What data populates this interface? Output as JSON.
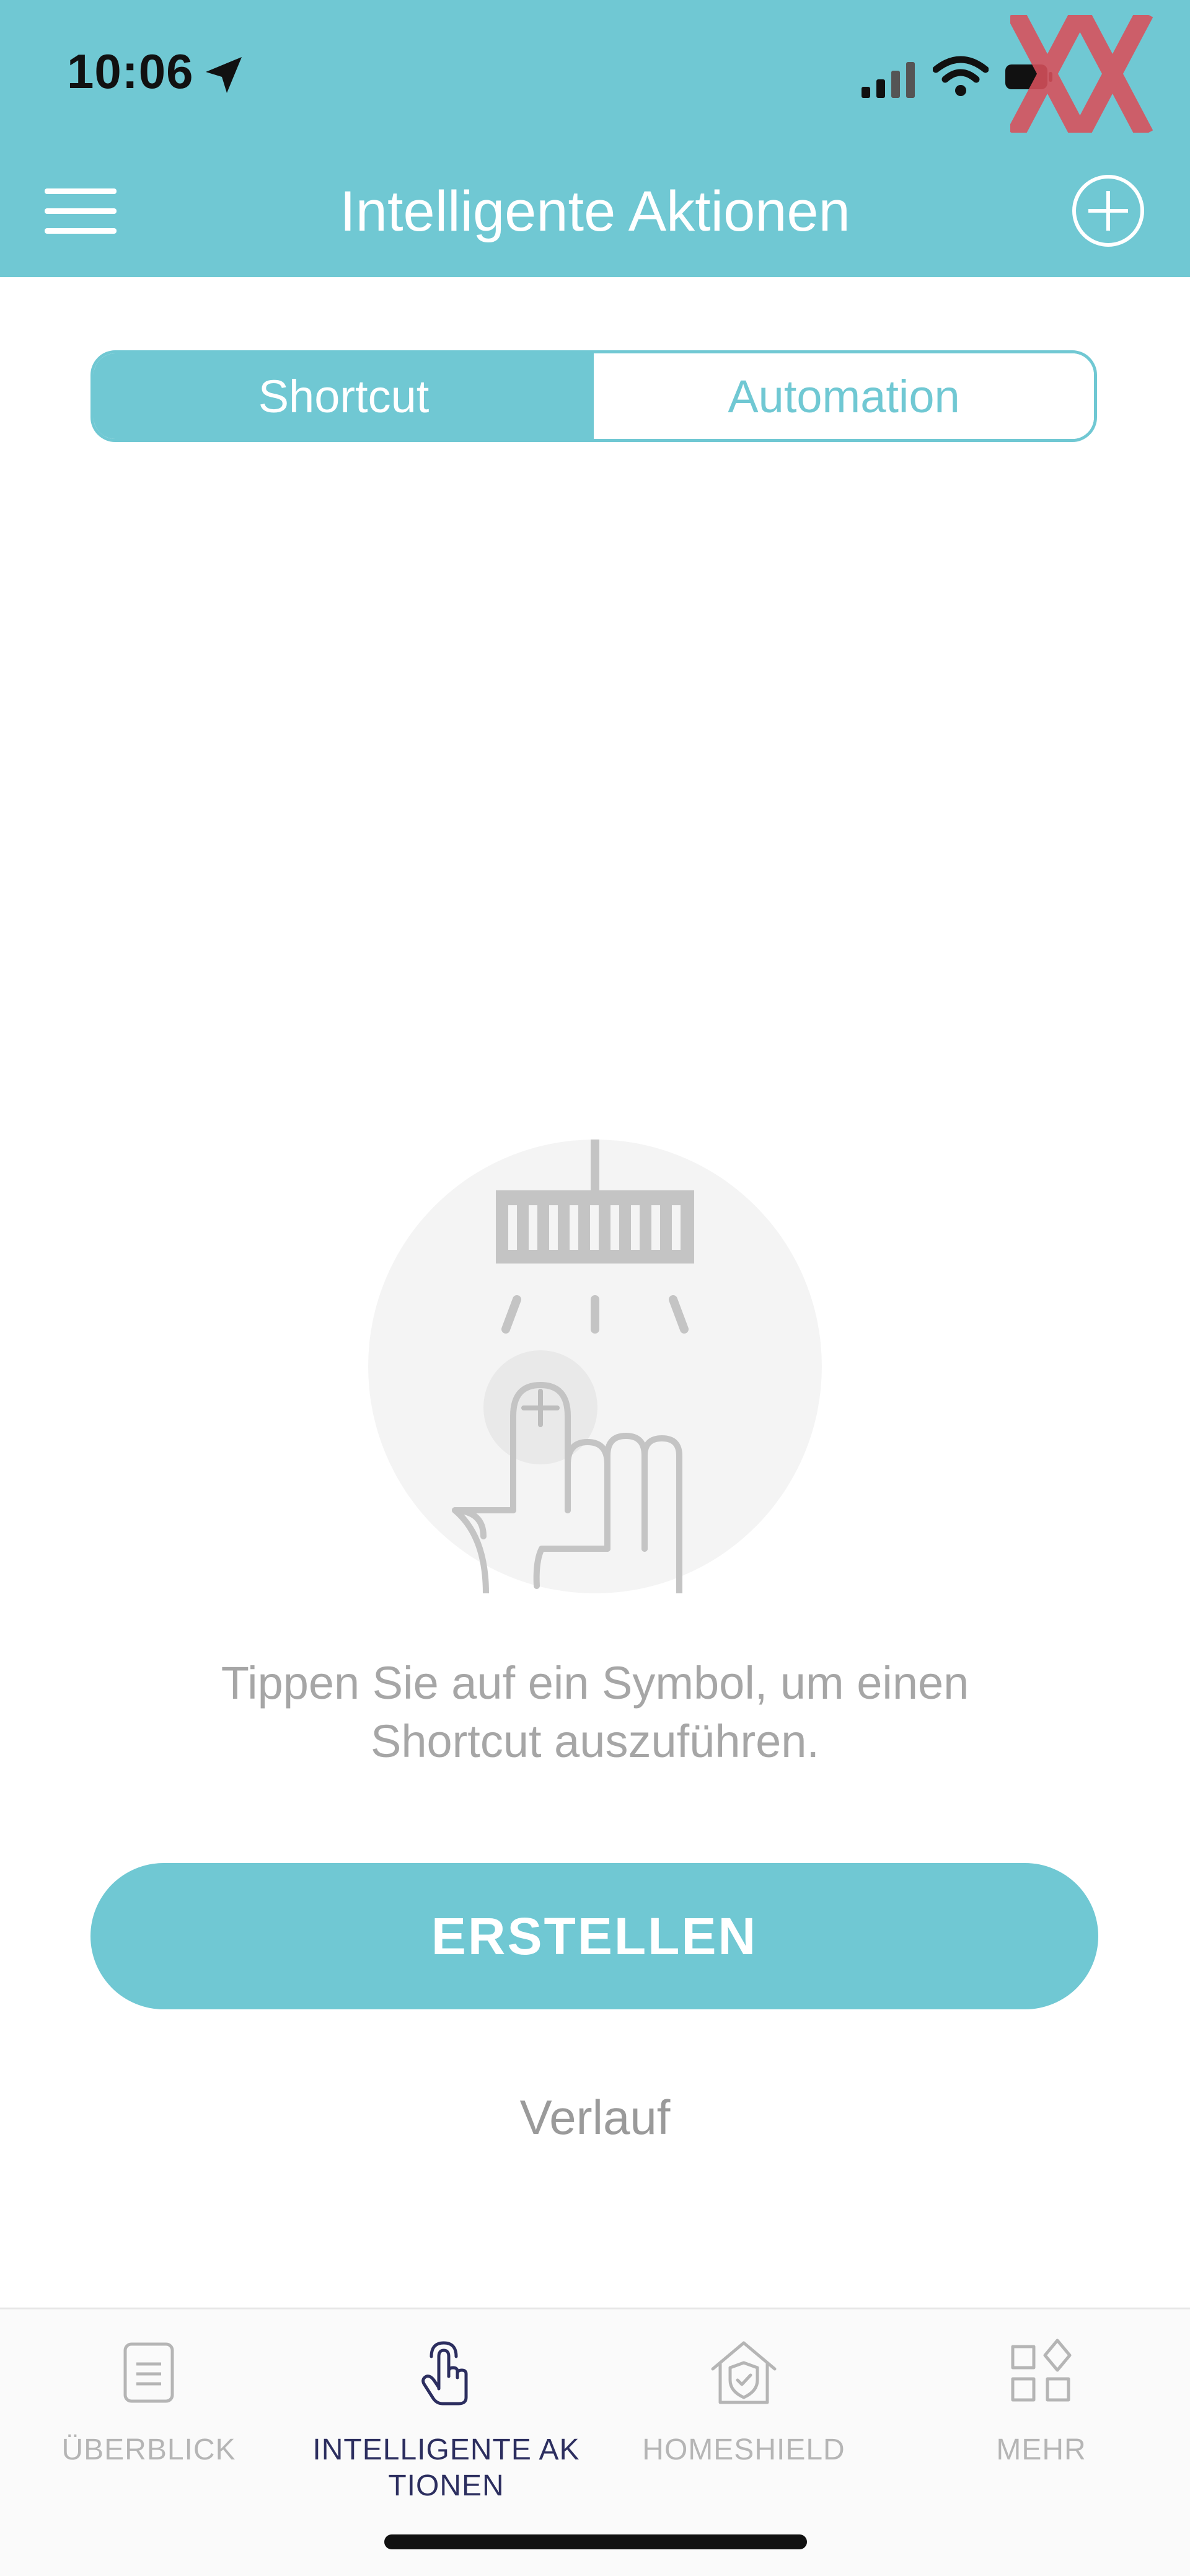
{
  "status_bar": {
    "time": "10:06"
  },
  "header": {
    "title": "Intelligente Aktionen"
  },
  "segments": [
    {
      "label": "Shortcut",
      "active": true
    },
    {
      "label": "Automation",
      "active": false
    }
  ],
  "empty_state": {
    "hint_line1": "Tippen Sie auf ein Symbol, um einen",
    "hint_line2": "Shortcut auszuführen."
  },
  "actions": {
    "create_label": "ERSTELLEN",
    "history_label": "Verlauf"
  },
  "tabbar": {
    "items": [
      {
        "label_line1": "ÜBERBLICK",
        "label_line2": "",
        "icon": "document-icon",
        "active": false
      },
      {
        "label_line1": "INTELLIGENTE AK",
        "label_line2": "TIONEN",
        "icon": "tap-hand-icon",
        "active": true
      },
      {
        "label_line1": "HOMESHIELD",
        "label_line2": "",
        "icon": "shield-home-icon",
        "active": false
      },
      {
        "label_line1": "MEHR",
        "label_line2": "",
        "icon": "grid-icon",
        "active": false
      }
    ]
  },
  "colors": {
    "accent": "#70c8d3",
    "active_tab": "#2c2e5f",
    "muted_text": "#a6a6a6"
  }
}
